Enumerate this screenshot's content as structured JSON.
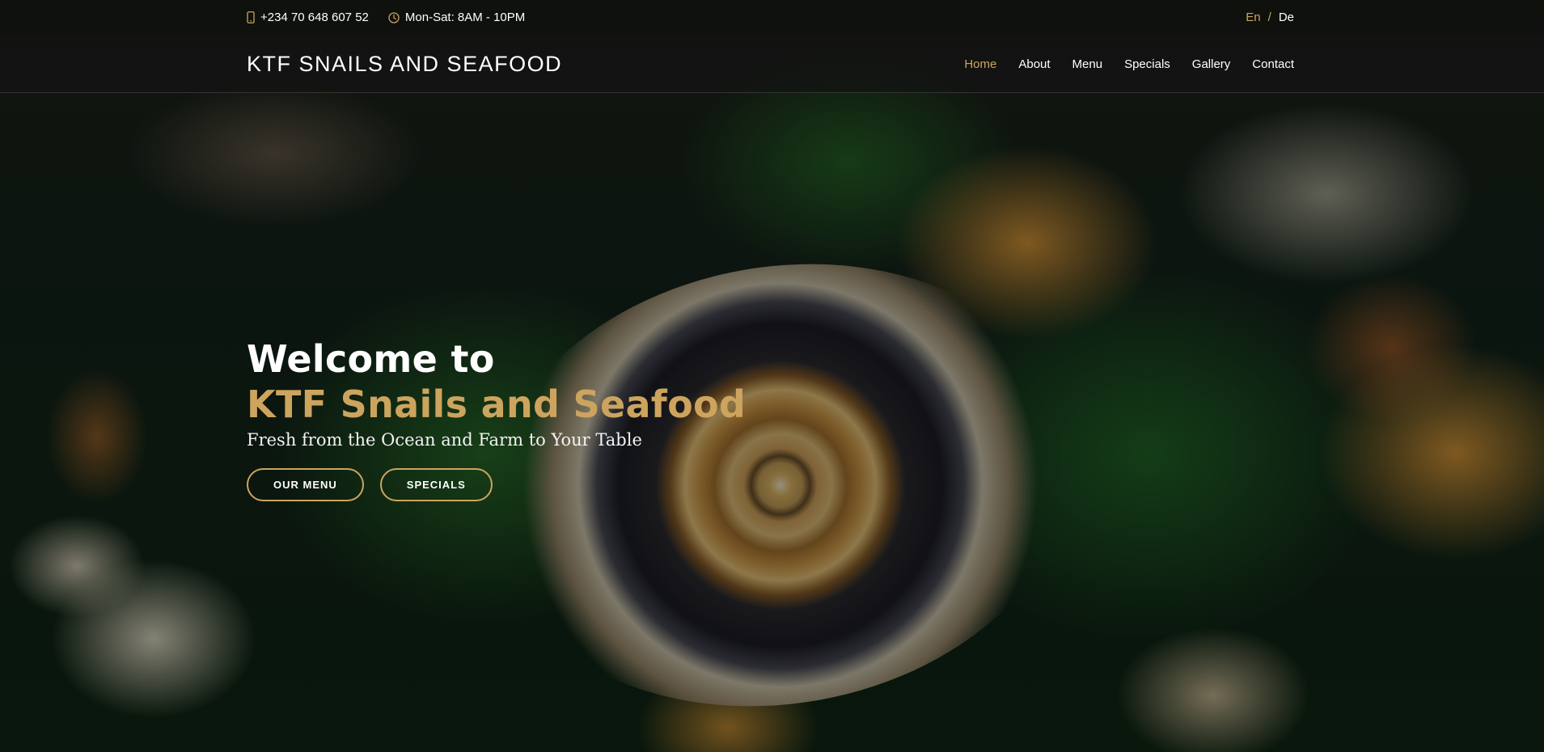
{
  "topbar": {
    "phone": "+234 70 648 607 52",
    "phone_icon": "mobile-phone-icon",
    "hours": "Mon-Sat: 8AM - 10PM",
    "hours_icon": "clock-icon",
    "lang": {
      "active": "En",
      "separator": "/",
      "other": "De"
    }
  },
  "header": {
    "logo": "KTF SNAILS AND SEAFOOD",
    "nav": [
      {
        "label": "Home",
        "active": true
      },
      {
        "label": "About"
      },
      {
        "label": "Menu"
      },
      {
        "label": "Specials"
      },
      {
        "label": "Gallery"
      },
      {
        "label": "Contact"
      }
    ]
  },
  "hero": {
    "title_line1": "Welcome to",
    "title_line2": "KTF Snails and Seafood",
    "subtitle": "Fresh from the Ocean and Farm to Your Table",
    "buttons": {
      "menu": "Our Menu",
      "specials": "Specials"
    }
  },
  "colors": {
    "accent": "#cda45e",
    "text": "#ffffff",
    "header_bg": "#141414"
  }
}
